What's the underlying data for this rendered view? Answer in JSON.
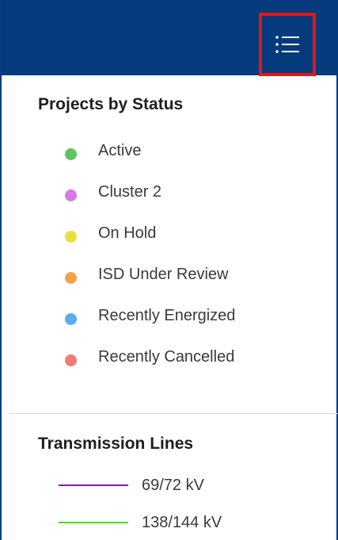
{
  "header": {
    "bg_color": "#053a7c",
    "legend_button_icon": "list-icon",
    "highlight_color": "#e01818"
  },
  "projects_by_status": {
    "title": "Projects by Status",
    "items": [
      {
        "label": "Active",
        "color": "#5dc55d"
      },
      {
        "label": "Cluster 2",
        "color": "#d57be6"
      },
      {
        "label": "On Hold",
        "color": "#e8df3e"
      },
      {
        "label": "ISD Under Review",
        "color": "#f6a24c"
      },
      {
        "label": "Recently Energized",
        "color": "#5aaef0"
      },
      {
        "label": "Recently Cancelled",
        "color": "#f47a72"
      }
    ]
  },
  "transmission_lines": {
    "title": "Transmission Lines",
    "items": [
      {
        "label": "69/72 kV",
        "color": "#8a10c8"
      },
      {
        "label": "138/144 kV",
        "color": "#44e01c"
      }
    ]
  }
}
